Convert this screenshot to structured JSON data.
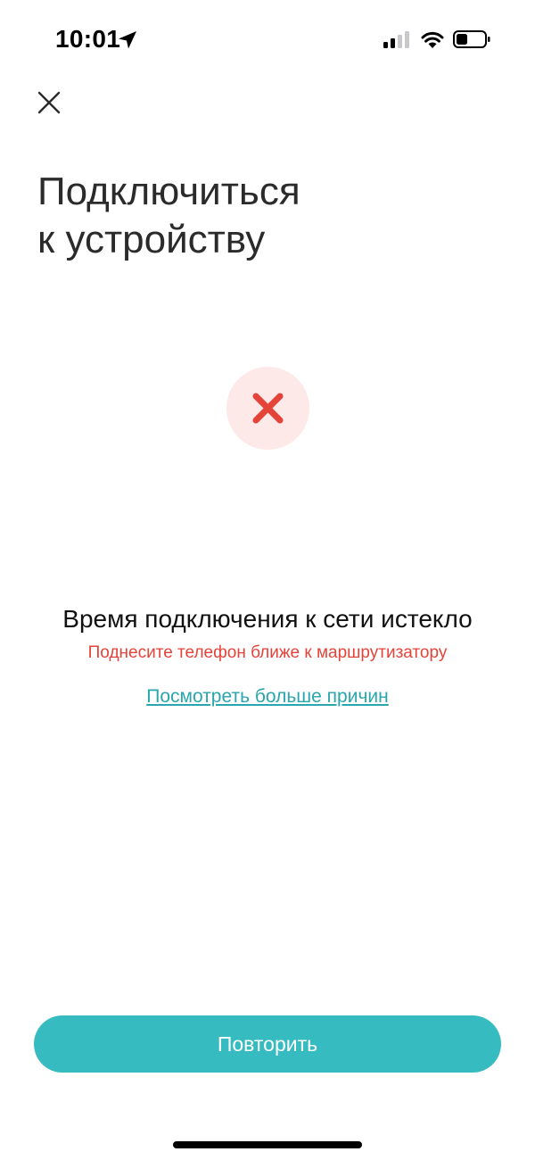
{
  "status_bar": {
    "time": "10:01",
    "icons": [
      "location-arrow-icon",
      "cellular-signal-icon",
      "wifi-icon",
      "battery-icon"
    ]
  },
  "header": {
    "close_icon": "close-icon",
    "title_line1": "Подключиться",
    "title_line2": "к устройству"
  },
  "status": {
    "icon": "error-x-icon",
    "title": "Время подключения к сети истекло",
    "hint": "Поднесите телефон ближе к маршрутизатору",
    "link": "Посмотреть больше причин"
  },
  "actions": {
    "retry_label": "Повторить"
  },
  "colors": {
    "accent": "#36bbc1",
    "link": "#2aa6ad",
    "error": "#e4433a",
    "error_bg": "#fde9e8"
  }
}
